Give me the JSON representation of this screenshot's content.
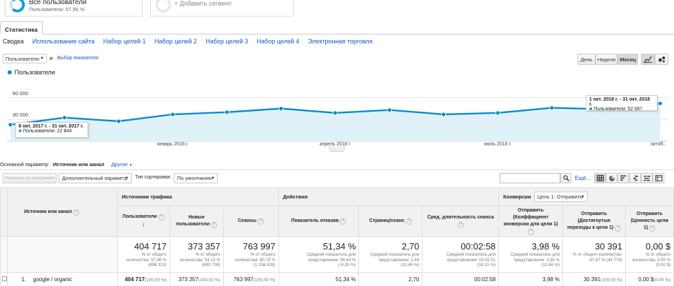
{
  "segments": [
    {
      "title": "Все пользователи",
      "subtitle": "Пользователи: 57,96 %"
    },
    {
      "title": "+ Добавить сегмент"
    }
  ],
  "tabs": [
    {
      "label": "Статистика"
    }
  ],
  "subnav": [
    "Сводка",
    "Использование сайта",
    "Набор целей 1",
    "Набор целей 2",
    "Набор целей 3",
    "Набор целей 4",
    "Электронная торговля"
  ],
  "controls": {
    "metric_select": "Пользователи",
    "and_label": "и",
    "choose_metric": "Выбор показателя",
    "period_buttons": [
      "День",
      "Неделя",
      "Месяц"
    ],
    "active_period": "Месяц"
  },
  "chart_data": {
    "type": "area",
    "legend": "Пользователи",
    "y_tick_labels": [
      "60 000",
      "30 000"
    ],
    "ylim": [
      0,
      90000
    ],
    "x_tick_labels": [
      "январь 2018 г.",
      "апрель 2018 г.",
      "июль 2018 г.",
      "октяб..."
    ],
    "x": [
      "окт. 2017",
      "ноя. 2017",
      "дек. 2017",
      "янв. 2018",
      "фев. 2018",
      "мар. 2018",
      "апр. 2018",
      "май 2018",
      "июн. 2018",
      "июл. 2018",
      "авг. 2018",
      "сен. 2018",
      "окт. 2018"
    ],
    "values": [
      22844,
      32500,
      27500,
      37000,
      40000,
      45000,
      39000,
      43000,
      37000,
      39000,
      46000,
      44000,
      52067
    ],
    "grid": true,
    "color": "#058dc7",
    "tooltip_left": {
      "title": "8 окт. 2017 г. - 31 окт. 2017 г.",
      "label": "Пользователи: 22 844"
    },
    "tooltip_right": {
      "title": "1 окт. 2018 г. - 31 окт. 2018 г.",
      "label": "Пользователи: 52 067"
    }
  },
  "params": {
    "primary_label": "Основной параметр:",
    "primary_value": "Источник или канал",
    "other": "Другое"
  },
  "toolbar": {
    "show_chart": "Показать на диаграмме",
    "secondary": "Дополнительный параметр",
    "sort_label": "Тип сортировки:",
    "sort_value": "По умолчанию",
    "search_more": "Ещё..."
  },
  "table": {
    "dim_header": "Источник или канал",
    "group_sources": "Источники трафика",
    "group_actions": "Действия",
    "group_conv": "Конверсии",
    "goal_select": "Цель 1: Отправить",
    "columns": [
      "Пользователи",
      "Новые пользователи",
      "Сеансы",
      "Показатель отказов",
      "Страниц/сеанс",
      "Сред. длительность сеанса",
      "Отправить (Коэффициент конверсии для цели 1)",
      "Отправить (Достигнутые переходы к цели 1)",
      "Отправить (Ценность цели 1)"
    ],
    "totals": [
      {
        "big": "404 717",
        "l1": "% от общего",
        "l2": "количества: 57,96 %",
        "l3": "(698 323)"
      },
      {
        "big": "373 357",
        "l1": "% от общего",
        "l2": "количества: 54,13 %",
        "l3": "(689 738)"
      },
      {
        "big": "763 997",
        "l1": "% от общего",
        "l2": "количества: 60,78 %",
        "l3": "(1 256 928)"
      },
      {
        "big": "51,34 %",
        "l1": "Средний показатель для",
        "l2": "представления: 56,64 %",
        "l3": "(-9,35 %)"
      },
      {
        "big": "2,70",
        "l1": "Средний показатель для",
        "l2": "представления: 2,44",
        "l3": "(10,45 %)"
      },
      {
        "big": "00:02:58",
        "l1": "Средний показатель для",
        "l2": "представления: 00:02:31",
        "l3": "(18,15 %)"
      },
      {
        "big": "3,98 %",
        "l1": "Средний показатель для",
        "l2": "представления: 3,56 %",
        "l3": "(11,66 %)"
      },
      {
        "big": "30 391",
        "l1": "% от общего количества:",
        "l2": "67,87 % (44 778)",
        "l3": ""
      },
      {
        "big": "0,00 $",
        "l1": "% от общего",
        "l2": "количества: 0,00 %",
        "l3": "(0,00 $)"
      }
    ],
    "rows": [
      {
        "idx": "1.",
        "name": "google / organic",
        "cells": [
          {
            "v": "404 717",
            "p": "(100,00 %)",
            "bold": true
          },
          {
            "v": "373 357",
            "p": "(100,00 %)"
          },
          {
            "v": "763 997",
            "p": "(100,00 %)"
          },
          {
            "v": "51,34 %",
            "p": ""
          },
          {
            "v": "2,70",
            "p": ""
          },
          {
            "v": "00:02:58",
            "p": ""
          },
          {
            "v": "3,98 %",
            "p": ""
          },
          {
            "v": "30 391",
            "p": "(100,00 %)"
          },
          {
            "v": "0,00 $",
            "p": "(0,00 %)"
          }
        ]
      }
    ]
  }
}
